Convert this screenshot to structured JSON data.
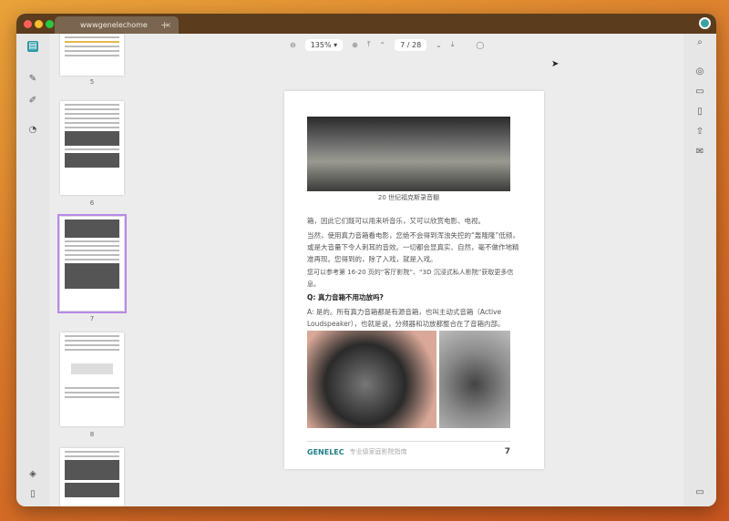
{
  "tab": {
    "title": "wwwgenelechome",
    "close": "×",
    "new": "+"
  },
  "toolbar": {
    "zoom": "135%",
    "zoom_caret": "▾",
    "page_current": "7",
    "page_sep": "/",
    "page_total": "28"
  },
  "thumbnails": [
    {
      "label": "5"
    },
    {
      "label": "6"
    },
    {
      "label": "7",
      "selected": true
    },
    {
      "label": "8"
    },
    {
      "label": ""
    }
  ],
  "page": {
    "caption": "20 世纪福克斯录音棚",
    "paragraphs": [
      "箱，因此它们既可以用来听音乐，又可以欣赏电影、电视。",
      "当然，使用真力音箱看电影，您绝不会得到浑浊失控的“轰隆隆”低频，或是大音量下令人刺耳的音效。一切都会显真实、自然，毫不做作地精准再现。您得到的，除了入戏，就是入戏。",
      "您可以参考第 16-20 页的“客厅影院”、“3D 沉浸式私人影院”获取更多信息。"
    ],
    "question": "Q: 真力音箱不用功放吗?",
    "answer": "A: 是的。所有真力音箱都是有源音箱，也叫主动式音箱（Active Loudspeaker），也就是说，分频器和功放都整合在了音箱内部。",
    "footer_logo": "GENELEC",
    "footer_text": "专业级家庭影院指南",
    "page_number": "7"
  },
  "colors": {
    "accent": "#b889e8",
    "titlebar": "#5b3c1c",
    "brand": "#1e7e86"
  }
}
